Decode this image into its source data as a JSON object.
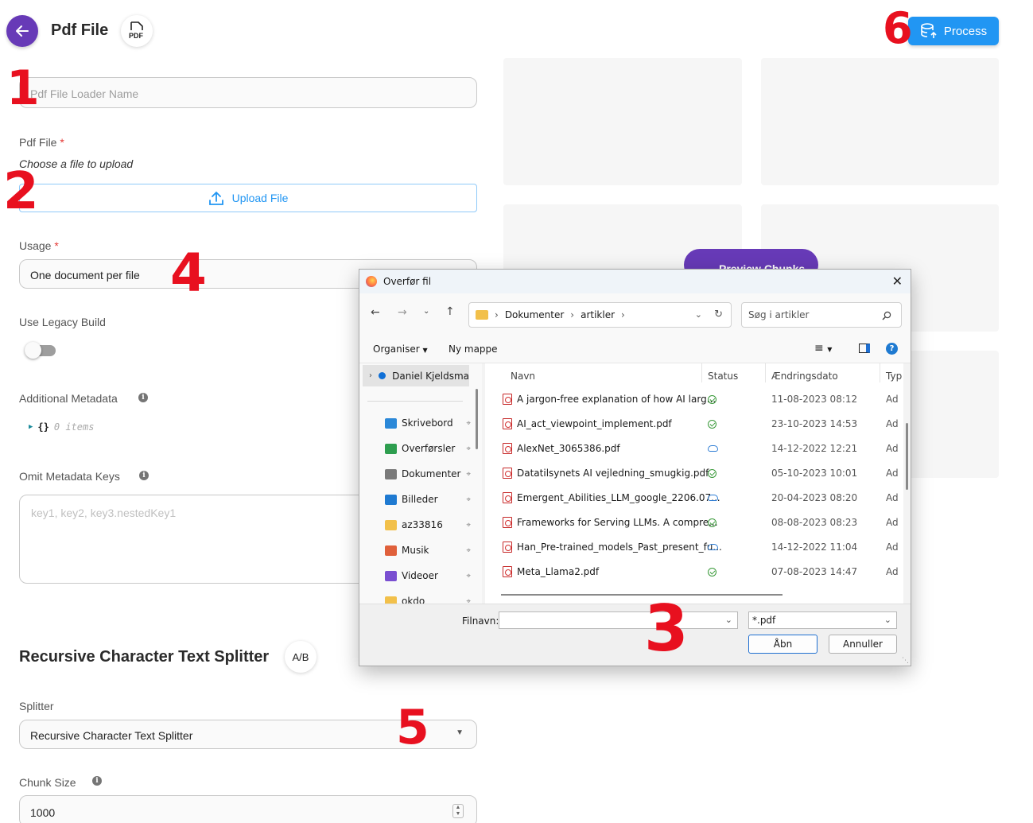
{
  "header": {
    "title": "Pdf File",
    "badge_text": "PDF",
    "process_label": "Process",
    "preview_label": "Preview Chunks"
  },
  "form": {
    "loader_name_placeholder": "Pdf File Loader Name",
    "pdf_file_label": "Pdf File",
    "required_mark": "*",
    "pdf_file_hint": "Choose a file to upload",
    "upload_label": "Upload File",
    "usage_label": "Usage",
    "usage_value": "One document per file",
    "legacy_label": "Use Legacy Build",
    "legacy_enabled": false,
    "additional_metadata_label": "Additional Metadata",
    "metadata_braces": "{}",
    "metadata_items": "0 items",
    "omit_keys_label": "Omit Metadata Keys",
    "omit_keys_placeholder": "key1, key2, key3.nestedKey1",
    "info_glyph": "i"
  },
  "splitter": {
    "section_title": "Recursive Character Text Splitter",
    "badge_text": "A/B",
    "splitter_label": "Splitter",
    "splitter_value": "Recursive Character Text Splitter",
    "chunk_size_label": "Chunk Size",
    "chunk_size_value": "1000"
  },
  "annotations": [
    "1",
    "2",
    "3",
    "4",
    "5",
    "6"
  ],
  "dialog": {
    "title": "Overfør fil",
    "breadcrumb": [
      "Dokumenter",
      "artikler"
    ],
    "search_placeholder": "Søg i artikler",
    "organize_label": "Organiser",
    "new_folder_label": "Ny mappe",
    "nav_root": "Daniel Kjeldsma",
    "nav_items": [
      {
        "label": "Skrivebord",
        "icon": "desktop-icon",
        "color": "#2b88d8"
      },
      {
        "label": "Overførsler",
        "icon": "download-icon",
        "color": "#2e9e4f"
      },
      {
        "label": "Dokumenter",
        "icon": "documents-icon",
        "color": "#7a7a7a"
      },
      {
        "label": "Billeder",
        "icon": "pictures-icon",
        "color": "#1f7ad1"
      },
      {
        "label": "az33816",
        "icon": "folder-icon",
        "color": "#f2c04a"
      },
      {
        "label": "Musik",
        "icon": "music-icon",
        "color": "#e0603b"
      },
      {
        "label": "Videoer",
        "icon": "videos-icon",
        "color": "#7a4fd1"
      },
      {
        "label": "okdo",
        "icon": "folder-icon",
        "color": "#f2c04a"
      }
    ],
    "columns": {
      "name": "Navn",
      "status": "Status",
      "date": "Ændringsdato",
      "type": "Typ"
    },
    "files": [
      {
        "name": "A jargon-free explanation of how AI larg...",
        "status": "synced",
        "date": "11-08-2023 08:12",
        "type": "Ad"
      },
      {
        "name": "AI_act_viewpoint_implement.pdf",
        "status": "synced",
        "date": "23-10-2023 14:53",
        "type": "Ad"
      },
      {
        "name": "AlexNet_3065386.pdf",
        "status": "cloud",
        "date": "14-12-2022 12:21",
        "type": "Ad"
      },
      {
        "name": "Datatilsynets AI vejledning_smugkig.pdf",
        "status": "synced",
        "date": "05-10-2023 10:01",
        "type": "Ad"
      },
      {
        "name": "Emergent_Abilities_LLM_google_2206.07...",
        "status": "cloud",
        "date": "20-04-2023 08:20",
        "type": "Ad"
      },
      {
        "name": "Frameworks for Serving LLMs. A compre...",
        "status": "synced",
        "date": "08-08-2023 08:23",
        "type": "Ad"
      },
      {
        "name": "Han_Pre-trained_models_Past_present_fu...",
        "status": "cloud",
        "date": "14-12-2022 11:04",
        "type": "Ad"
      },
      {
        "name": "Meta_Llama2.pdf",
        "status": "synced",
        "date": "07-08-2023 14:47",
        "type": "Ad"
      }
    ],
    "filename_label": "Filnavn:",
    "filename_value": "",
    "filter_value": "*.pdf",
    "open_label": "Åbn",
    "cancel_label": "Annuller"
  }
}
